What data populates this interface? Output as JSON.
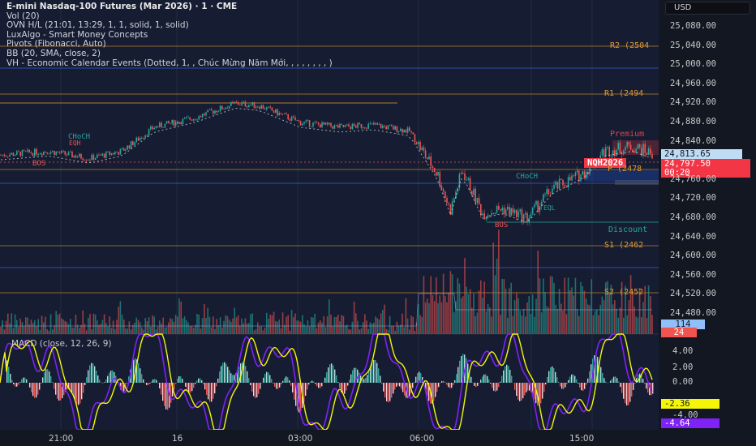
{
  "legend": {
    "title": "E-mini Nasdaq-100 Futures (Mar 2026) · 1 · CME",
    "indicators": [
      "Vol (20)",
      "OVN H/L (21:01, 13:29, 1, 1, solid, 1, solid)",
      "LuxAlgo - Smart Money Concepts",
      "Pivots (Fibonacci, Auto)",
      "BB (20, SMA, close, 2)",
      "VH - Economic Calendar Events (Dotted, 1, , Chúc Mừng Năm Mới, , , , , , , , )"
    ]
  },
  "currency": "USD",
  "price_axis": [
    "25,080.00",
    "25,040.00",
    "25,000.00",
    "24,960.00",
    "24,920.00",
    "24,880.00",
    "24,840.00",
    "24,760.00",
    "24,720.00",
    "24,680.00",
    "24,640.00",
    "24,600.00",
    "24,560.00",
    "24,520.00",
    "24,480.00"
  ],
  "macd_axis": [
    "4.00",
    "2.00",
    "0.00",
    "-4.00"
  ],
  "time_axis": [
    "21:00",
    "16",
    "03:00",
    "06:00",
    "15:00"
  ],
  "pivots": {
    "r2": "R2 (2504",
    "r1": "R1 (2494",
    "p": "P (2478",
    "s1": "S1 (2462",
    "s2": "S2 (2452"
  },
  "zones": {
    "premium": "Premium",
    "discount": "Discount"
  },
  "smc_labels": {
    "bos": "BOS",
    "choch": "CHoCH",
    "eql": "EQL",
    "eqh": "EQH"
  },
  "tags": {
    "bid": "24,813.65",
    "symbol": "NQH2026",
    "last": "24,797.50",
    "countdown": "00:20",
    "vol": "114",
    "vol2": "24",
    "macd_signal": "-2.36",
    "macd": "-4.64"
  },
  "macd_label": "MACD (close, 12, 26, 9)",
  "colors": {
    "up": "#26a69a",
    "down": "#ef5350",
    "pivot": "#e39b2b",
    "macd": "#7e22f5",
    "signal": "#f5f50a"
  }
}
